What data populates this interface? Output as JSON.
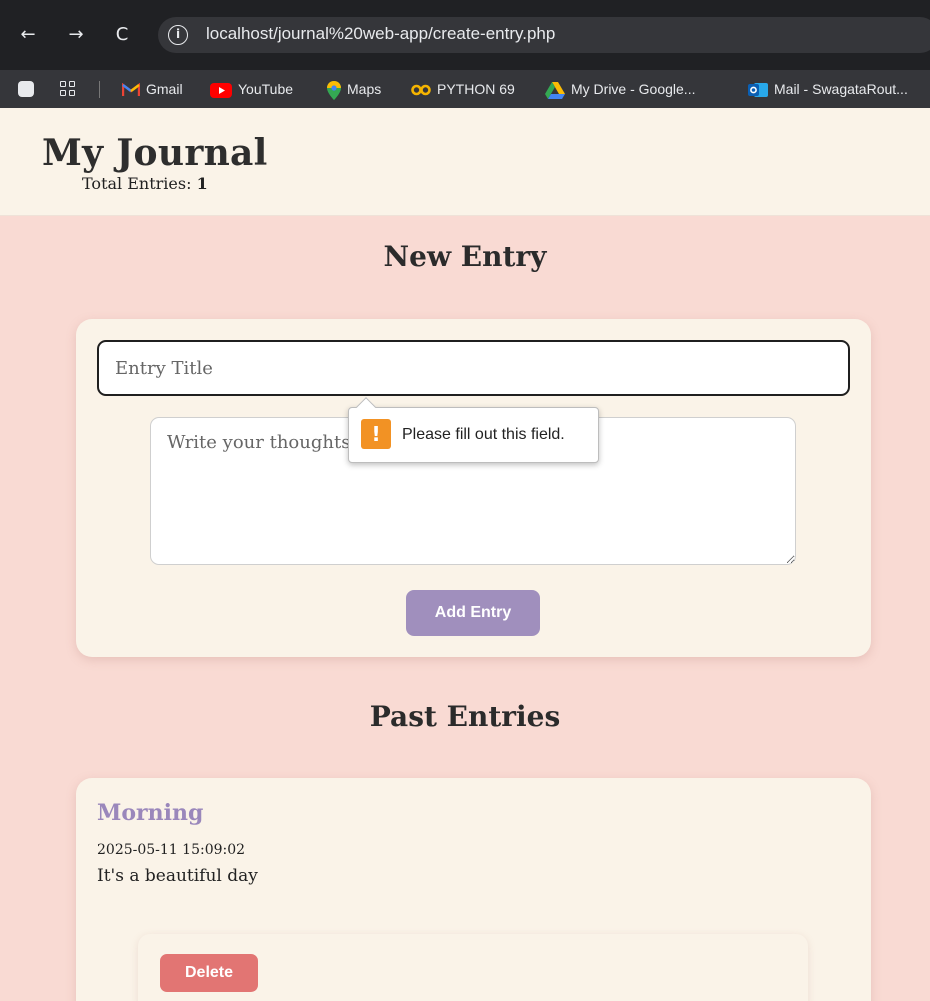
{
  "browser": {
    "back_icon": "←",
    "forward_icon": "→",
    "reload_icon": "C",
    "info_icon": "i",
    "url": "localhost/journal%20web-app/create-entry.php",
    "bookmarks": [
      {
        "label": "Gmail",
        "icon": "gmail-icon"
      },
      {
        "label": "YouTube",
        "icon": "youtube-icon"
      },
      {
        "label": "Maps",
        "icon": "maps-icon"
      },
      {
        "label": "PYTHON 69",
        "icon": "coursera-icon"
      },
      {
        "label": "My Drive - Google...",
        "icon": "drive-icon"
      },
      {
        "label": "Mail - SwagataRout...",
        "icon": "outlook-icon"
      }
    ]
  },
  "header": {
    "title": "My Journal",
    "total_label": "Total Entries:",
    "total_count": "1"
  },
  "new_entry": {
    "heading": "New Entry",
    "title_placeholder": "Entry Title",
    "content_placeholder": "Write your thoughts...",
    "submit_label": "Add Entry",
    "validation_message": "Please fill out this field.",
    "validation_icon": "!"
  },
  "past_entries": {
    "heading": "Past Entries",
    "items": [
      {
        "title": "Morning",
        "timestamp": "2025-05-11 15:09:02",
        "body": "It's a beautiful day",
        "delete_label": "Delete"
      }
    ]
  },
  "colors": {
    "page_bg": "#f9dad3",
    "card_bg": "#faf3e8",
    "accent_purple": "#a08fbd",
    "delete_red": "#e27573",
    "warning_orange": "#f29224"
  }
}
